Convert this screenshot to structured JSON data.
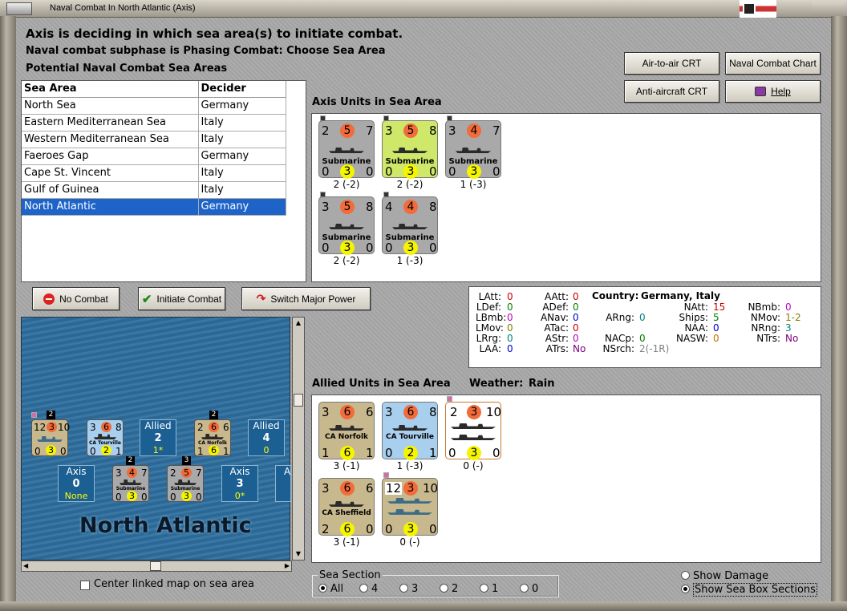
{
  "window": {
    "title": "Naval Combat In North Atlantic (Axis)"
  },
  "header": {
    "line1": "Axis is deciding in which sea area(s) to initiate combat.",
    "line2": "Naval combat subphase is Phasing Combat: Choose Sea Area",
    "line3": "Potential Naval Combat Sea Areas"
  },
  "buttons": {
    "air_to_air": "Air-to-air CRT",
    "naval_chart": "Naval Combat Chart",
    "anti_aircraft": "Anti-aircraft CRT",
    "help": "Help",
    "no_combat": "No Combat",
    "initiate_combat": "Initiate Combat",
    "switch_major": "Switch Major Power"
  },
  "sea_table": {
    "headers": [
      "Sea Area",
      "Decider"
    ],
    "rows": [
      {
        "area": "North Sea",
        "decider": "Germany"
      },
      {
        "area": "Eastern Mediterranean Sea",
        "decider": "Italy"
      },
      {
        "area": "Western Mediterranean Sea",
        "decider": "Italy"
      },
      {
        "area": "Faeroes Gap",
        "decider": "Germany"
      },
      {
        "area": "Cape St. Vincent",
        "decider": "Italy"
      },
      {
        "area": "Gulf of Guinea",
        "decider": "Italy"
      },
      {
        "area": "North Atlantic",
        "decider": "Germany"
      }
    ]
  },
  "axis_section": {
    "title": "Axis Units in Sea Area",
    "units": [
      {
        "name": "Submarine",
        "tl": "2",
        "tc": "5",
        "tr": "7",
        "bl": "0",
        "bc": "3",
        "br": "0",
        "caption": "2 (-2)",
        "bg": "#a9a9a9"
      },
      {
        "name": "Submarine",
        "tl": "3",
        "tc": "5",
        "tr": "8",
        "bl": "0",
        "bc": "3",
        "br": "0",
        "caption": "2 (-2)",
        "bg": "#cfe86a"
      },
      {
        "name": "Submarine",
        "tl": "3",
        "tc": "4",
        "tr": "7",
        "bl": "0",
        "bc": "3",
        "br": "0",
        "caption": "1 (-3)",
        "bg": "#a9a9a9"
      },
      {
        "name": "Submarine",
        "tl": "3",
        "tc": "5",
        "tr": "8",
        "bl": "0",
        "bc": "3",
        "br": "0",
        "caption": "2 (-2)",
        "bg": "#a9a9a9"
      },
      {
        "name": "Submarine",
        "tl": "4",
        "tc": "4",
        "tr": "8",
        "bl": "0",
        "bc": "3",
        "br": "0",
        "caption": "1 (-3)",
        "bg": "#a9a9a9"
      }
    ]
  },
  "stats": {
    "country_label": "Country:",
    "country": "Germany, Italy",
    "left": [
      {
        "k": "LAtt:",
        "v": "0",
        "c": "#cc0000"
      },
      {
        "k": "LDef:",
        "v": "0",
        "c": "#008000"
      },
      {
        "k": "LBmb:",
        "v": "0",
        "c": "#c000c0"
      },
      {
        "k": "LMov:",
        "v": "0",
        "c": "#808000"
      },
      {
        "k": "LRrg:",
        "v": "0",
        "c": "#008080"
      },
      {
        "k": "LAA:",
        "v": "0",
        "c": "#0000cc"
      }
    ],
    "mid": [
      {
        "k": "AAtt:",
        "v": "0",
        "c": "#cc0000"
      },
      {
        "k": "ADef:",
        "v": "0",
        "c": "#008000"
      },
      {
        "k": "ANav:",
        "v": "0",
        "c": "#0000cc"
      },
      {
        "k": "ATac:",
        "v": "0",
        "c": "#cc0000"
      },
      {
        "k": "AStr:",
        "v": "0",
        "c": "#c000c0"
      },
      {
        "k": "ATrs:",
        "v": "No",
        "c": "#800080"
      }
    ],
    "mid2": [
      {
        "k": "ARng:",
        "v": "0",
        "c": "#008080"
      },
      {
        "k": "NACp:",
        "v": "0",
        "c": "#008000"
      },
      {
        "k": "NSrch:",
        "v": "2(-1R)",
        "c": "#808080"
      }
    ],
    "right1": [
      {
        "k": "NAtt:",
        "v": "15",
        "c": "#cc0000"
      },
      {
        "k": "Ships:",
        "v": "5",
        "c": "#008000"
      },
      {
        "k": "NAA:",
        "v": "0",
        "c": "#0000cc"
      },
      {
        "k": "NASW:",
        "v": "0",
        "c": "#c07000"
      }
    ],
    "right2": [
      {
        "k": "NBmb:",
        "v": "0",
        "c": "#c000c0"
      },
      {
        "k": "NMov:",
        "v": "1-2",
        "c": "#808000"
      },
      {
        "k": "NRng:",
        "v": "3",
        "c": "#008080"
      },
      {
        "k": "NTrs:",
        "v": "No",
        "c": "#800080"
      }
    ]
  },
  "allied_section": {
    "title": "Allied Units in Sea Area",
    "weather_label": "Weather:",
    "weather": "Rain",
    "units": [
      {
        "name": "CA Norfolk",
        "tl": "3",
        "tc": "6",
        "tr": "6",
        "bl": "1",
        "bc": "6",
        "br": "1",
        "caption": "3 (-1)",
        "bg": "#c8b88e"
      },
      {
        "name": "CA Tourville",
        "tl": "3",
        "tc": "6",
        "tr": "8",
        "bl": "0",
        "bc": "2",
        "br": "1",
        "caption": "1 (-3)",
        "bg": "#a9cfee"
      },
      {
        "name": "",
        "tl": "2",
        "tc": "3",
        "tr": "10",
        "bl": "0",
        "bc": "3",
        "br": "0",
        "caption": "0 (-)",
        "bg": "#ffffff"
      },
      {
        "name": "CA Sheffield",
        "tl": "3",
        "tc": "6",
        "tr": "6",
        "bl": "2",
        "bc": "6",
        "br": "0",
        "caption": "3 (-1)",
        "bg": "#c8b88e"
      },
      {
        "name": "",
        "tl": "12",
        "tc": "3",
        "tr": "10",
        "bl": "0",
        "bc": "3",
        "br": "0",
        "caption": "0 (-)",
        "bg": "#c8b88e"
      }
    ]
  },
  "map": {
    "sea_name": "North Atlantic",
    "allied_box1": {
      "title": "Allied",
      "value": "2",
      "sub": "1*"
    },
    "allied_box2": {
      "title": "Allied",
      "value": "4",
      "sub": "0"
    },
    "axis_box1": {
      "title": "Axis",
      "value": "0",
      "sub": "None"
    },
    "axis_box2": {
      "title": "Axis",
      "value": "3",
      "sub": "0*"
    },
    "axis_box3": {
      "title": "A"
    },
    "unit1": {
      "tl": "12",
      "tc": "3",
      "tr": "10",
      "bl": "0",
      "bc": "3",
      "br": "0",
      "stack": "2"
    },
    "unit2": {
      "name": "CA Tourville",
      "tl": "3",
      "tc": "6",
      "tr": "8",
      "bl": "0",
      "bc": "2",
      "br": "1"
    },
    "unit3": {
      "name": "CA Norfolk",
      "tl": "2",
      "tc": "6",
      "tr": "6",
      "bl": "1",
      "bc": "6",
      "br": "1",
      "stack": "2"
    },
    "unit4": {
      "name": "Submarine",
      "tl": "3",
      "tc": "4",
      "tr": "7",
      "bl": "0",
      "bc": "3",
      "br": "0",
      "stack": "2"
    },
    "unit5": {
      "name": "Submarine",
      "tl": "2",
      "tc": "5",
      "tr": "7",
      "bl": "0",
      "bc": "3",
      "br": "0",
      "stack": "3"
    }
  },
  "center_map_label": "Center linked map on sea area",
  "sea_section": {
    "title": "Sea Section",
    "options": [
      "All",
      "4",
      "3",
      "2",
      "1",
      "0"
    ],
    "selected": "All"
  },
  "display_options": {
    "show_damage": "Show Damage",
    "show_sections": "Show Sea Box Sections"
  },
  "colors": {
    "selection": "#1e64c8",
    "sea": "#2e6f9e",
    "power_circle": "#f26b3a",
    "defense_circle": "#f5f500"
  }
}
